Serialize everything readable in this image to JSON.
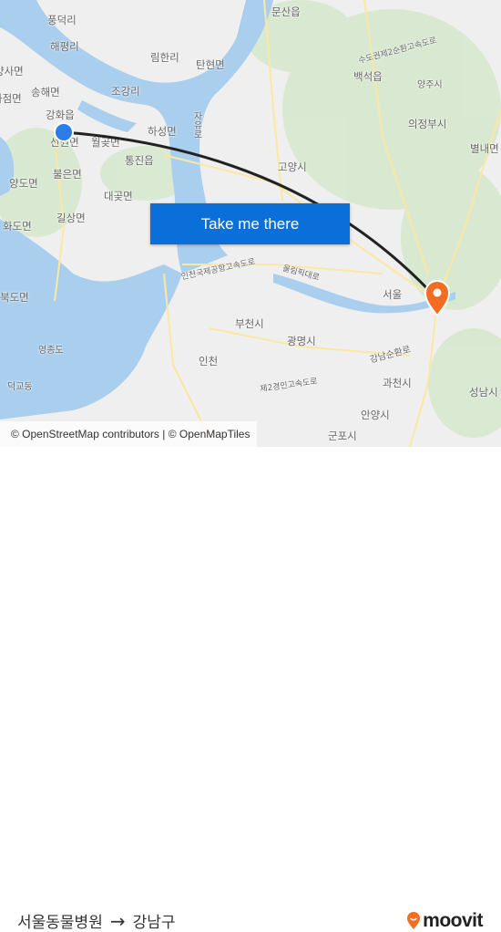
{
  "map": {
    "labels": [
      "풍덕리",
      "해평리",
      "림한리",
      "탄현면",
      "문산읍",
      "양사면",
      "송해면",
      "하점면",
      "조강리",
      "강화읍",
      "하성면",
      "선원면",
      "월곶면",
      "통진읍",
      "불은면",
      "양도면",
      "대곶면",
      "길상면",
      "화도면",
      "북도면",
      "영종도",
      "덕교동",
      "백석읍",
      "양주시",
      "의정부시",
      "별내면",
      "고양시",
      "자유로",
      "인천국제공항고속도로",
      "올림픽대로",
      "부천시",
      "광명시",
      "인천",
      "강남순환로",
      "과천시",
      "안양시",
      "군포시",
      "성남시",
      "제2경인고속도로",
      "수도권제2순환고속도로",
      "서울"
    ],
    "origin_color": "#2b7de9",
    "destination_color": "#f26c22",
    "route_color": "#222222",
    "water_color": "#aacfee",
    "land_color": "#efefef"
  },
  "cta": {
    "label": "Take me there"
  },
  "attribution": "© OpenStreetMap contributors | © OpenMapTiles",
  "footer": {
    "origin": "서울동물병원",
    "arrow_icon": "arrow-right-icon",
    "destination": "강남구",
    "brand": "moovit",
    "brand_color": "#f26c22"
  }
}
